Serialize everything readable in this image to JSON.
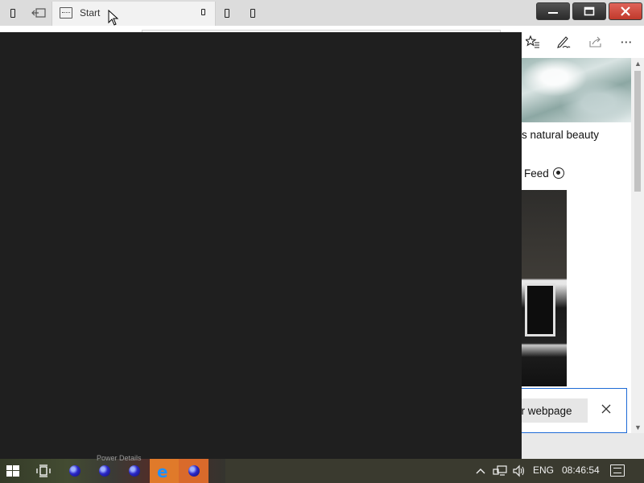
{
  "tab": {
    "title": "Start",
    "icon": "newtab-page-icon"
  },
  "window_controls": {
    "minimize_icon": "minimize-icon",
    "maximize_icon": "maximize-icon",
    "close_icon": "close-icon"
  },
  "toolbar": {
    "icons": [
      "favorites-icon",
      "pen-notes-icon",
      "share-icon",
      "more-icon"
    ],
    "more_glyph": "⋯"
  },
  "content": {
    "story_title": "s natural beauty",
    "feed_label": "Feed",
    "prompt_button": "er webpage"
  },
  "taskbar": {
    "power_details_label": "Power Details",
    "language": "ENG",
    "time": "08:46:54"
  },
  "colors": {
    "overlay": "#1f1f1f",
    "accent_blue": "#1e6bd6",
    "taskbar_tile": "#e07a2a"
  }
}
